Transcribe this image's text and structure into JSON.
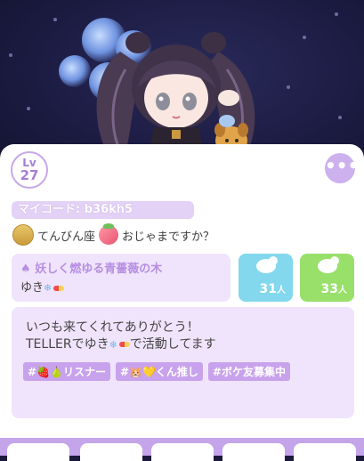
{
  "profile": {
    "level_label": "Lv",
    "level": "27",
    "more_label": "•••",
    "my_code": "マイコード: b36kh5",
    "zodiac": "てんびん座",
    "status": "おじゃまですか？"
  },
  "club": {
    "title": "妖しく燃ゆる青薔薇の木",
    "member": "ゆき"
  },
  "stats": {
    "followers": "31",
    "following": "33",
    "unit": "人"
  },
  "bio": {
    "line1": "いつも来てくれてありがとう！",
    "line2_prefix": "TELLERでゆき",
    "line2_suffix": "で活動してます",
    "tags": [
      "#🍓🍐リスナー",
      "#🐹💛くん推し",
      "#ボケ友募集中"
    ]
  },
  "colors": {
    "accent": "#c8a2ec",
    "followers_bg": "#83d8ee",
    "following_bg": "#98e06a",
    "panel_bg": "#efe4fb"
  }
}
